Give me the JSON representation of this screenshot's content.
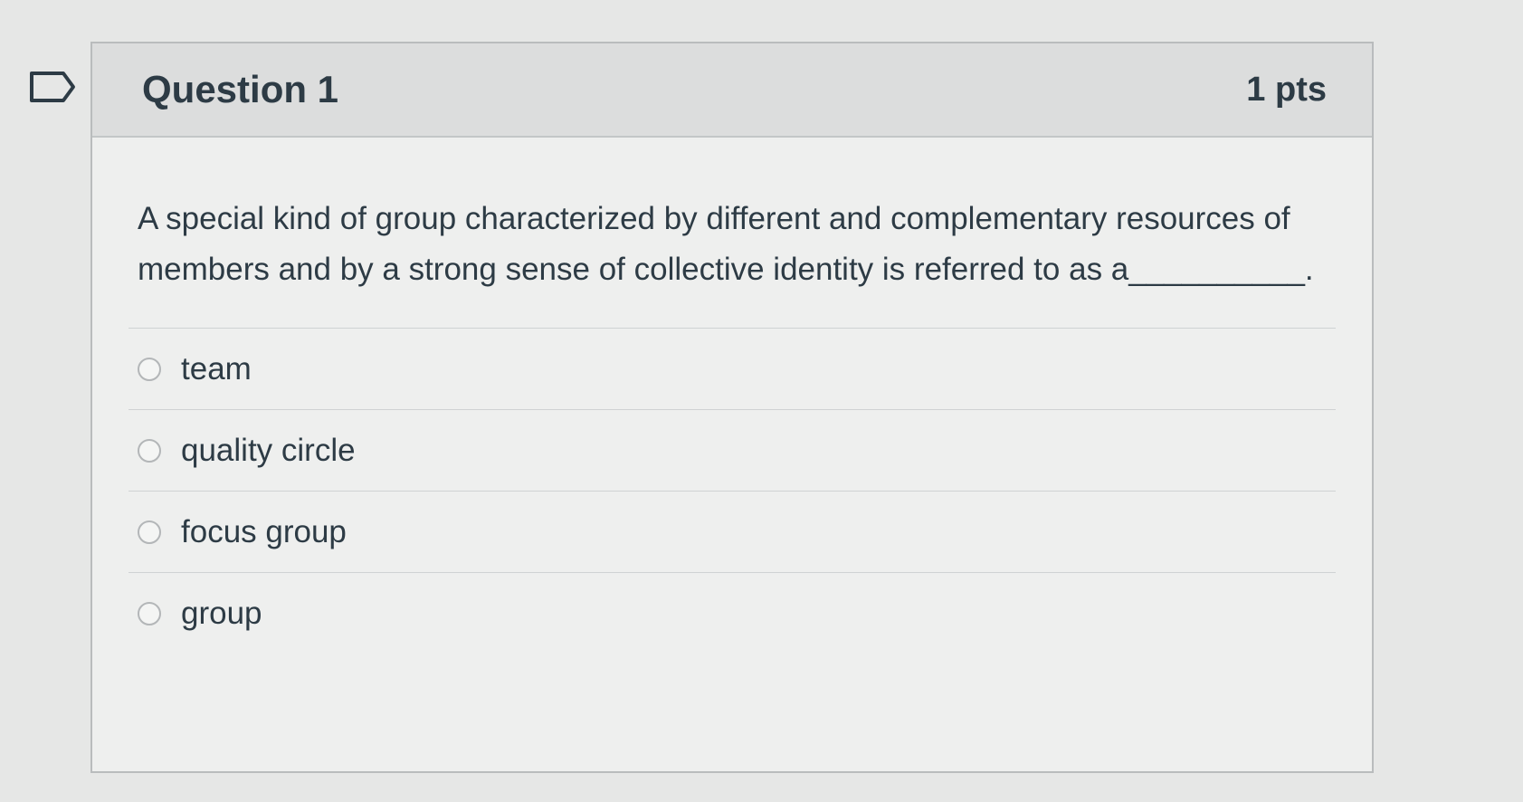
{
  "question": {
    "title": "Question 1",
    "points": "1 pts",
    "text": "A special kind of group characterized by different and complementary resources of members and by a strong sense of collective identity is referred to as a__________.",
    "answers": [
      {
        "label": "team"
      },
      {
        "label": "quality circle"
      },
      {
        "label": "focus group"
      },
      {
        "label": "group"
      }
    ]
  },
  "icons": {
    "flag": "flag-outline-icon",
    "radio": "radio-unchecked-icon"
  },
  "colors": {
    "text": "#2d3b45",
    "header_bg": "#dcdddd",
    "card_bg": "#eeefee",
    "border": "#b9bcbd"
  }
}
